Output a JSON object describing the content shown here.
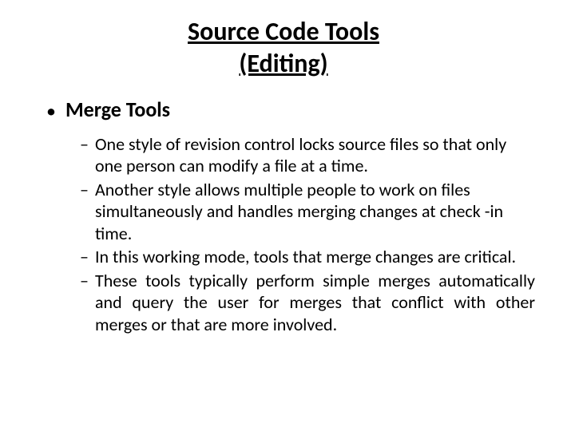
{
  "title": {
    "line1": "Source Code Tools",
    "line2": "(Editing)"
  },
  "section_heading": "Merge Tools",
  "bullets": [
    "One style of revision control locks source files so that only one person can modify a file at a time.",
    "Another style allows multiple people to work on files simultaneously and handles merging changes at check -in time.",
    "In this working mode, tools that merge changes are critical.",
    "These tools typically perform simple merges automatically and query the user for merges that conflict with other merges or that are more involved."
  ]
}
